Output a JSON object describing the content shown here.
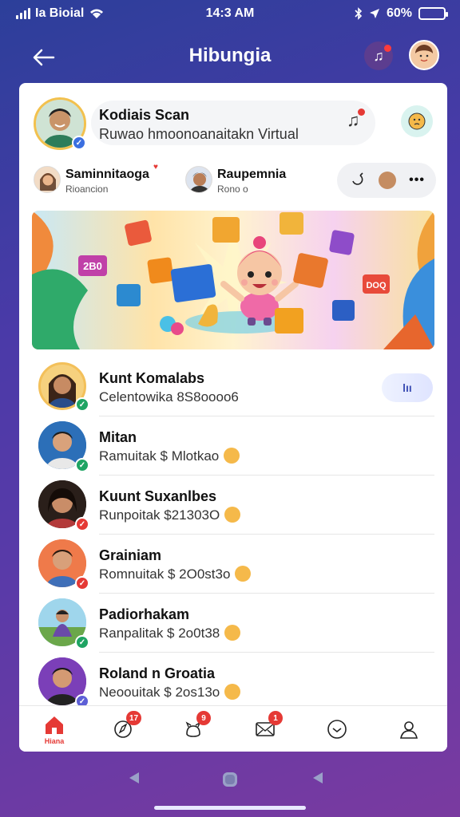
{
  "status": {
    "carrier": "Ia Bioial",
    "time": "14:3 AM",
    "battery": "60%",
    "battery_level": 0.6
  },
  "header": {
    "title": "Hibungia"
  },
  "featured": {
    "name": "Kodiais Scan",
    "subtitle": "Ruwao hmoonoanaitakn Virtual"
  },
  "row2": [
    {
      "name": "Saminnitaoga",
      "sub": "Rioancion"
    },
    {
      "name": "Raupemnia",
      "sub": "Rono o"
    }
  ],
  "contacts": [
    {
      "name": "Kunt Komalabs",
      "sub": "Celentowika 8S8oooo6",
      "action": "lıı",
      "badge_color": "#1fa463"
    },
    {
      "name": "Mitan",
      "sub": "Ramuitak $ Mlotkao",
      "badge_color": "#1fa463"
    },
    {
      "name": "Kuunt Suxanlbes",
      "sub": "Runpoitak $21303O",
      "badge_color": "#e53935"
    },
    {
      "name": "Grainiam",
      "sub": "Romnuitak $ 2O0st3o",
      "badge_color": "#e53935"
    },
    {
      "name": "Padiorhakam",
      "sub": "Ranpalitak $ 2o0t38",
      "badge_color": "#1fa463"
    },
    {
      "name": "Roland n Groatia",
      "sub": "Neoouitak $ 2os13o",
      "badge_color": "#5d5fd6"
    }
  ],
  "nav": [
    {
      "id": "home",
      "label": "Hiana",
      "icon": "home-icon",
      "badge": ""
    },
    {
      "id": "discover",
      "label": "",
      "icon": "compass-icon",
      "badge": "17"
    },
    {
      "id": "pets",
      "label": "",
      "icon": "pet-icon",
      "badge": "9"
    },
    {
      "id": "mail",
      "label": "",
      "icon": "mail-icon",
      "badge": "1"
    },
    {
      "id": "chat",
      "label": "",
      "icon": "chat-icon",
      "badge": ""
    },
    {
      "id": "profile",
      "label": "",
      "icon": "user-icon",
      "badge": ""
    }
  ],
  "banner": {
    "tiles": [
      "2B0",
      "DOQ"
    ]
  },
  "colors": {
    "accent": "#e53935",
    "verified_green": "#1fa463"
  }
}
